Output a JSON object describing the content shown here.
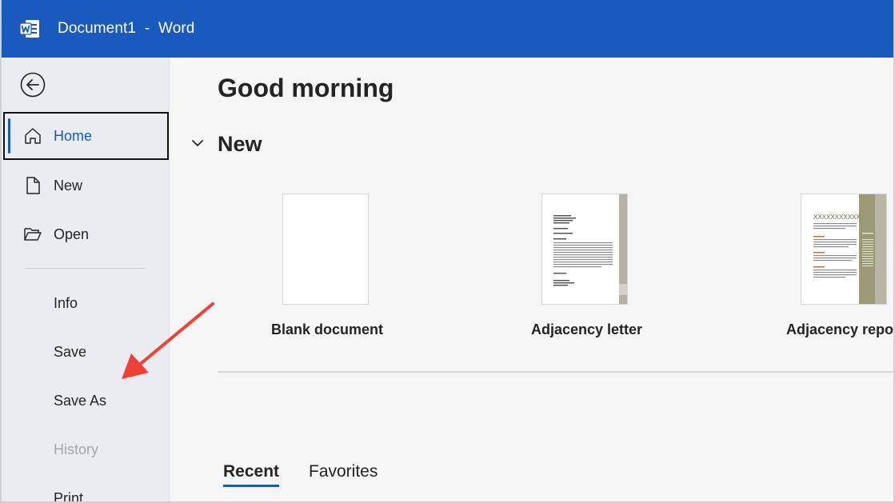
{
  "window": {
    "title": "Document1  -  Word",
    "accent_color": "#185abd"
  },
  "sidebar": {
    "back_icon": "arrow-left-circle-icon",
    "primary": [
      {
        "label": "Home",
        "icon": "home-icon",
        "active": true
      },
      {
        "label": "New",
        "icon": "document-icon"
      },
      {
        "label": "Open",
        "icon": "folder-open-icon"
      }
    ],
    "secondary": [
      {
        "label": "Info",
        "disabled": false
      },
      {
        "label": "Save",
        "disabled": false
      },
      {
        "label": "Save As",
        "disabled": false
      },
      {
        "label": "History",
        "disabled": true
      },
      {
        "label": "Print",
        "disabled": false
      }
    ]
  },
  "main": {
    "greeting": "Good morning",
    "new_section": {
      "title": "New",
      "templates": [
        {
          "label": "Blank document"
        },
        {
          "label": "Adjacency letter"
        },
        {
          "label": "Adjacency report"
        }
      ],
      "report_heading": "XXXXXXXXXXX"
    },
    "tabs": [
      {
        "label": "Recent",
        "active": true
      },
      {
        "label": "Favorites",
        "active": false
      }
    ]
  },
  "annotation": {
    "color": "#ef4136"
  }
}
